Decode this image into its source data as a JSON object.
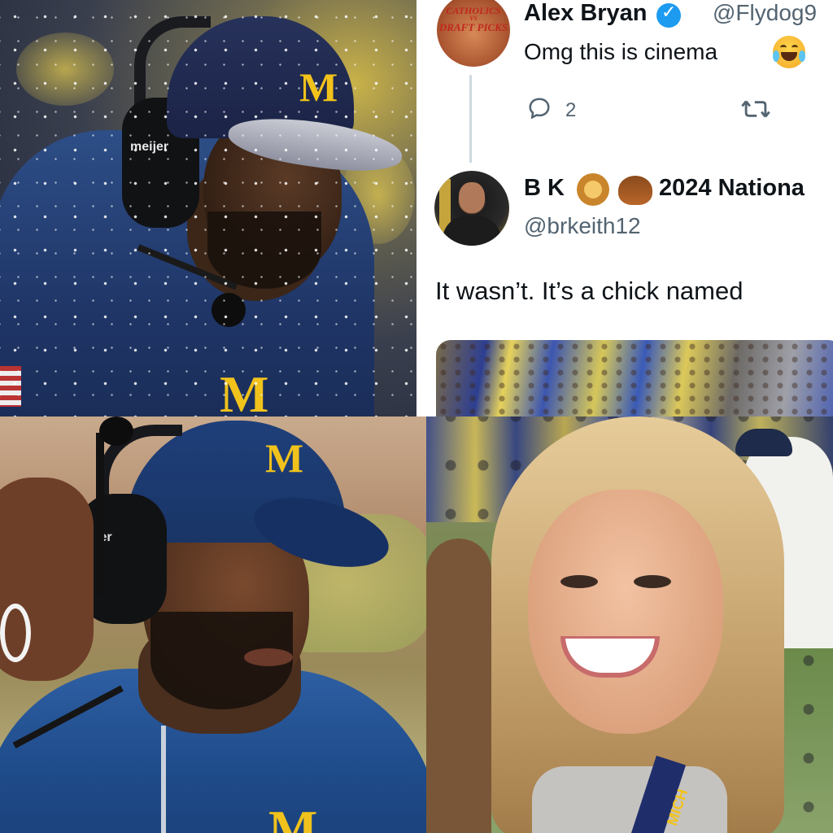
{
  "colors": {
    "michigan_maize": "#f1c21b",
    "michigan_blue": "#1f3f7a",
    "twitter_text": "#0f1419",
    "twitter_secondary": "#536471",
    "twitter_verified": "#1d9bf0",
    "thread_line": "#cfd9de"
  },
  "panels": {
    "top_left": {
      "cap_logo": "M",
      "headset_label": "meijer",
      "jacket_logo": "M"
    },
    "tweet_thread": {
      "tweet1": {
        "avatar_text_line1": "CATHOLICS",
        "avatar_text_line2": "VS",
        "avatar_text_line3": "DRAFT PICKS",
        "display_name": "Alex Bryan",
        "verified_icon": "verified-check-icon",
        "handle": "@Flydog9",
        "text": "Omg this is cinema",
        "emoji": "tears-of-joy-icon",
        "reply_count": "2"
      },
      "tweet2": {
        "display_name": "B K",
        "name_emojis": [
          "lion-icon",
          "acorn-icon"
        ],
        "name_suffix": "2024 Nationa",
        "handle": "@brkeith12",
        "text": "It wasn’t. It’s a chick named"
      }
    },
    "bottom_left": {
      "cap_logo": "M",
      "headset_label": "ier",
      "jacket_logo": "M"
    },
    "bottom_right": {
      "lanyard_text": "MICH"
    }
  }
}
